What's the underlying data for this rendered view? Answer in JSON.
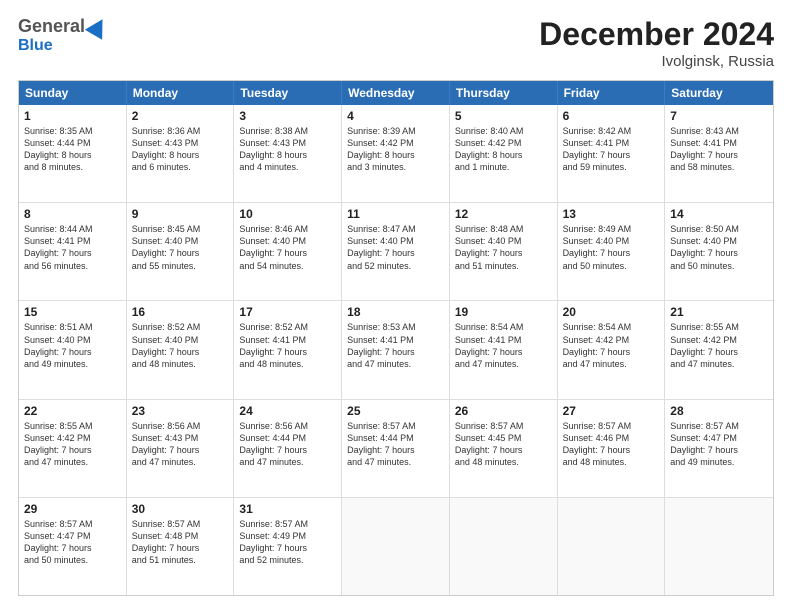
{
  "header": {
    "logo_general": "General",
    "logo_blue": "Blue",
    "main_title": "December 2024",
    "subtitle": "Ivolginsk, Russia"
  },
  "calendar": {
    "days_of_week": [
      "Sunday",
      "Monday",
      "Tuesday",
      "Wednesday",
      "Thursday",
      "Friday",
      "Saturday"
    ],
    "rows": [
      [
        {
          "day": "1",
          "text": "Sunrise: 8:35 AM\nSunset: 4:44 PM\nDaylight: 8 hours\nand 8 minutes."
        },
        {
          "day": "2",
          "text": "Sunrise: 8:36 AM\nSunset: 4:43 PM\nDaylight: 8 hours\nand 6 minutes."
        },
        {
          "day": "3",
          "text": "Sunrise: 8:38 AM\nSunset: 4:43 PM\nDaylight: 8 hours\nand 4 minutes."
        },
        {
          "day": "4",
          "text": "Sunrise: 8:39 AM\nSunset: 4:42 PM\nDaylight: 8 hours\nand 3 minutes."
        },
        {
          "day": "5",
          "text": "Sunrise: 8:40 AM\nSunset: 4:42 PM\nDaylight: 8 hours\nand 1 minute."
        },
        {
          "day": "6",
          "text": "Sunrise: 8:42 AM\nSunset: 4:41 PM\nDaylight: 7 hours\nand 59 minutes."
        },
        {
          "day": "7",
          "text": "Sunrise: 8:43 AM\nSunset: 4:41 PM\nDaylight: 7 hours\nand 58 minutes."
        }
      ],
      [
        {
          "day": "8",
          "text": "Sunrise: 8:44 AM\nSunset: 4:41 PM\nDaylight: 7 hours\nand 56 minutes."
        },
        {
          "day": "9",
          "text": "Sunrise: 8:45 AM\nSunset: 4:40 PM\nDaylight: 7 hours\nand 55 minutes."
        },
        {
          "day": "10",
          "text": "Sunrise: 8:46 AM\nSunset: 4:40 PM\nDaylight: 7 hours\nand 54 minutes."
        },
        {
          "day": "11",
          "text": "Sunrise: 8:47 AM\nSunset: 4:40 PM\nDaylight: 7 hours\nand 52 minutes."
        },
        {
          "day": "12",
          "text": "Sunrise: 8:48 AM\nSunset: 4:40 PM\nDaylight: 7 hours\nand 51 minutes."
        },
        {
          "day": "13",
          "text": "Sunrise: 8:49 AM\nSunset: 4:40 PM\nDaylight: 7 hours\nand 50 minutes."
        },
        {
          "day": "14",
          "text": "Sunrise: 8:50 AM\nSunset: 4:40 PM\nDaylight: 7 hours\nand 50 minutes."
        }
      ],
      [
        {
          "day": "15",
          "text": "Sunrise: 8:51 AM\nSunset: 4:40 PM\nDaylight: 7 hours\nand 49 minutes."
        },
        {
          "day": "16",
          "text": "Sunrise: 8:52 AM\nSunset: 4:40 PM\nDaylight: 7 hours\nand 48 minutes."
        },
        {
          "day": "17",
          "text": "Sunrise: 8:52 AM\nSunset: 4:41 PM\nDaylight: 7 hours\nand 48 minutes."
        },
        {
          "day": "18",
          "text": "Sunrise: 8:53 AM\nSunset: 4:41 PM\nDaylight: 7 hours\nand 47 minutes."
        },
        {
          "day": "19",
          "text": "Sunrise: 8:54 AM\nSunset: 4:41 PM\nDaylight: 7 hours\nand 47 minutes."
        },
        {
          "day": "20",
          "text": "Sunrise: 8:54 AM\nSunset: 4:42 PM\nDaylight: 7 hours\nand 47 minutes."
        },
        {
          "day": "21",
          "text": "Sunrise: 8:55 AM\nSunset: 4:42 PM\nDaylight: 7 hours\nand 47 minutes."
        }
      ],
      [
        {
          "day": "22",
          "text": "Sunrise: 8:55 AM\nSunset: 4:42 PM\nDaylight: 7 hours\nand 47 minutes."
        },
        {
          "day": "23",
          "text": "Sunrise: 8:56 AM\nSunset: 4:43 PM\nDaylight: 7 hours\nand 47 minutes."
        },
        {
          "day": "24",
          "text": "Sunrise: 8:56 AM\nSunset: 4:44 PM\nDaylight: 7 hours\nand 47 minutes."
        },
        {
          "day": "25",
          "text": "Sunrise: 8:57 AM\nSunset: 4:44 PM\nDaylight: 7 hours\nand 47 minutes."
        },
        {
          "day": "26",
          "text": "Sunrise: 8:57 AM\nSunset: 4:45 PM\nDaylight: 7 hours\nand 48 minutes."
        },
        {
          "day": "27",
          "text": "Sunrise: 8:57 AM\nSunset: 4:46 PM\nDaylight: 7 hours\nand 48 minutes."
        },
        {
          "day": "28",
          "text": "Sunrise: 8:57 AM\nSunset: 4:47 PM\nDaylight: 7 hours\nand 49 minutes."
        }
      ],
      [
        {
          "day": "29",
          "text": "Sunrise: 8:57 AM\nSunset: 4:47 PM\nDaylight: 7 hours\nand 50 minutes."
        },
        {
          "day": "30",
          "text": "Sunrise: 8:57 AM\nSunset: 4:48 PM\nDaylight: 7 hours\nand 51 minutes."
        },
        {
          "day": "31",
          "text": "Sunrise: 8:57 AM\nSunset: 4:49 PM\nDaylight: 7 hours\nand 52 minutes."
        },
        {
          "day": "",
          "text": ""
        },
        {
          "day": "",
          "text": ""
        },
        {
          "day": "",
          "text": ""
        },
        {
          "day": "",
          "text": ""
        }
      ]
    ]
  }
}
